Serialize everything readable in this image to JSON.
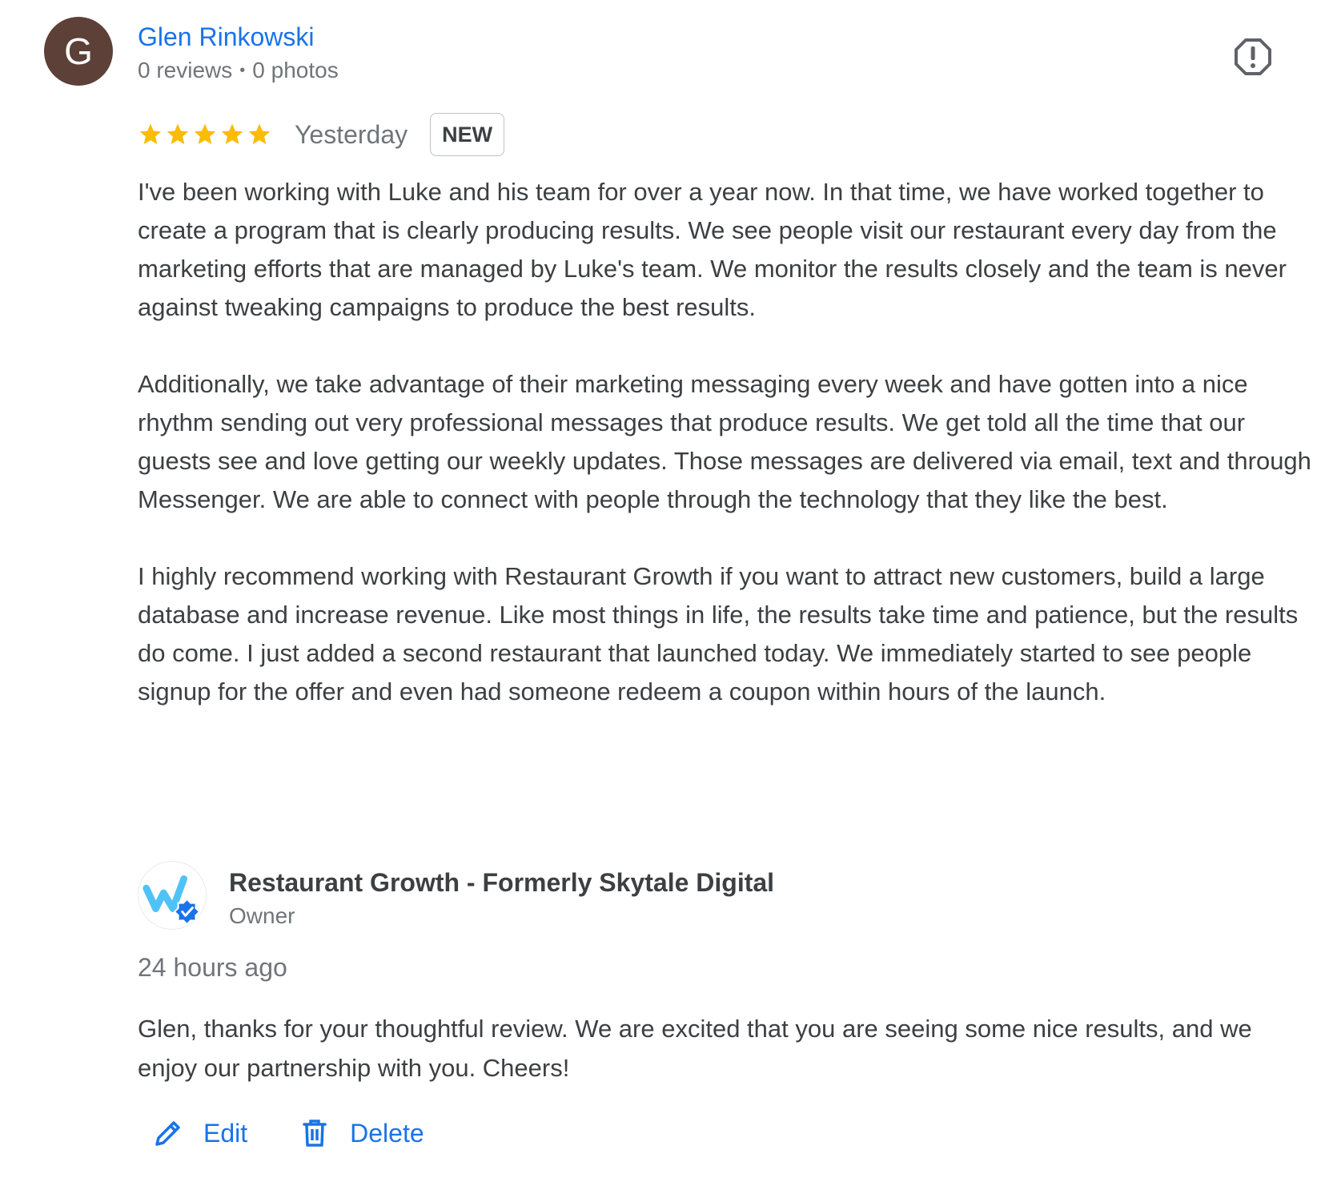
{
  "review": {
    "avatar_letter": "G",
    "avatar_color": "#5d4037",
    "reviewer_name": "Glen Rinkowski",
    "reviews_count": "0 reviews",
    "separator": "•",
    "photos_count": "0 photos",
    "rating": 5,
    "max_rating": 5,
    "date": "Yesterday",
    "badge": "NEW",
    "paragraphs": [
      "I've been working with Luke and his team for over a year now. In that time, we have worked together to create a program that is clearly producing results. We see people visit our restaurant every day from the marketing efforts that are managed by Luke's team. We monitor the results closely and the team is never against tweaking campaigns to produce the best results.",
      "Additionally, we take advantage of their marketing messaging every week and have gotten into a nice rhythm sending out very professional messages that produce results. We get told all the time that our guests see and love getting our weekly updates. Those messages are delivered via email, text and through Messenger. We are able to connect with people through the technology that they like the best.",
      "I highly recommend working with Restaurant Growth if you want to attract new customers, build a large database and increase revenue. Like most things in life, the results take time and patience, but the results do come. I just added a second restaurant that launched today. We immediately started to see people signup for the offer and even had someone redeem a coupon within hours of the launch."
    ]
  },
  "reply": {
    "owner_name": "Restaurant Growth - Formerly Skytale Digital",
    "owner_role": "Owner",
    "time": "24 hours ago",
    "text": "Glen, thanks for your thoughtful review. We are excited that you are seeing some nice results, and we enjoy our partnership with you. Cheers!"
  },
  "actions": {
    "edit_label": "Edit",
    "delete_label": "Delete"
  },
  "icons": {
    "flag": "report-flag-icon",
    "star": "star-icon",
    "owner_logo": "owner-logo-w-icon",
    "verified": "verified-badge-icon",
    "edit": "pencil-icon",
    "delete": "trash-icon"
  },
  "colors": {
    "link_blue": "#1a73e8",
    "star_gold": "#fbbc04",
    "logo_cyan": "#4fc3f7",
    "verified_blue": "#1a73e8",
    "text": "#3c4043",
    "secondary_text": "#70757a"
  }
}
